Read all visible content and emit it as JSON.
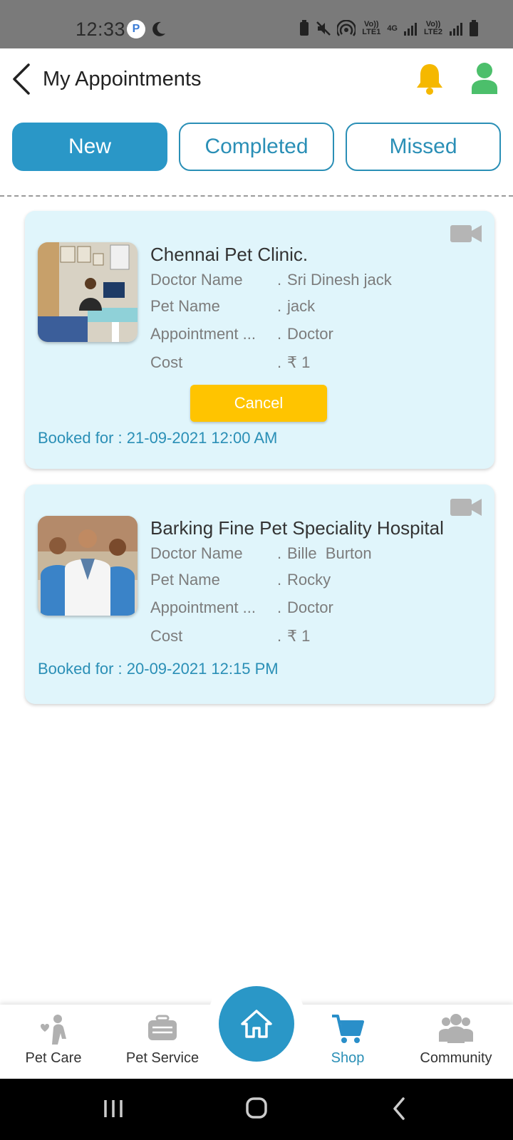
{
  "status_bar": {
    "time": "12:33",
    "network_1": "Vo)) LTE1",
    "network_2": "4G",
    "network_3": "Vo)) LTE2"
  },
  "header": {
    "title": "My Appointments"
  },
  "tabs": [
    {
      "label": "New",
      "active": true
    },
    {
      "label": "Completed",
      "active": false
    },
    {
      "label": "Missed",
      "active": false
    }
  ],
  "appointments": [
    {
      "clinic": "Chennai Pet Clinic.",
      "rows": [
        {
          "label": "Doctor Name",
          "value": "Sri Dinesh jack"
        },
        {
          "label": "Pet Name",
          "value": "jack"
        },
        {
          "label": "Appointment ...",
          "value": "Doctor"
        },
        {
          "label": "Cost",
          "value": "₹ 1"
        }
      ],
      "cancel_label": "Cancel",
      "booked_label": "Booked for :",
      "booked_value": "21-09-2021 12:00 AM"
    },
    {
      "clinic": "Barking Fine Pet Speciality Hospital",
      "rows": [
        {
          "label": "Doctor Name",
          "value": "Bille  Burton"
        },
        {
          "label": "Pet Name",
          "value": "Rocky"
        },
        {
          "label": "Appointment ...",
          "value": "Doctor"
        },
        {
          "label": "Cost",
          "value": "₹ 1"
        }
      ],
      "booked_label": "Booked for :",
      "booked_value": "20-09-2021 12:15 PM"
    }
  ],
  "separator": ".",
  "bottom_nav": {
    "items": [
      {
        "label": "Pet Care",
        "icon": "pet-care-icon"
      },
      {
        "label": "Pet Service",
        "icon": "pet-carrier-icon"
      },
      {
        "label": "Shop",
        "icon": "cart-icon"
      },
      {
        "label": "Community",
        "icon": "community-icon"
      }
    ],
    "home_icon": "home-icon"
  },
  "colors": {
    "primary": "#2a97c7",
    "card_bg": "#e0f5fb",
    "cancel": "#ffc400",
    "bell": "#f5b800",
    "user": "#4cbf6b"
  }
}
